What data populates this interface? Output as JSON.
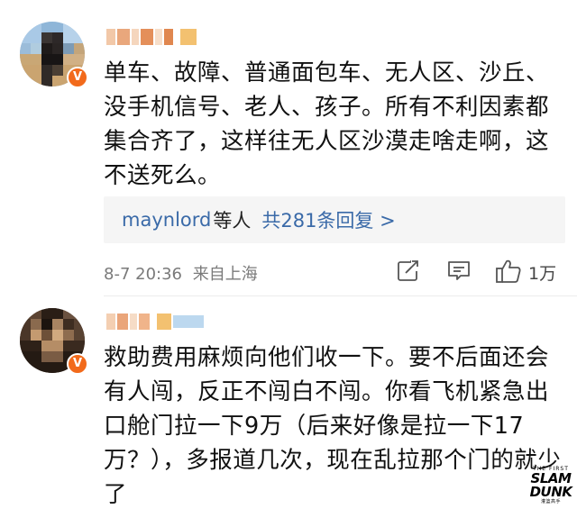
{
  "comments": [
    {
      "content": "单车、故障、普通面包车、无人区、沙丘、没手机信号、老人、孩子。所有不利因素都集合齐了，这样往无人区沙漠走啥走啊，这不送死么。",
      "replies": {
        "user": "maynlord",
        "mid": "等人",
        "count_text": "共281条回复 >"
      },
      "date": "8-7 20:36",
      "location": "来自上海",
      "likes": "1万"
    },
    {
      "content": "救助费用麻烦向他们收一下。要不后面还会有人闯，反正不闯白不闯。你看飞机紧急出口舱门拉一下9万（后来好像是拉一下17万？），多报道几次，现在乱拉那个门的就少了"
    }
  ],
  "watermark": {
    "line1": "THE FIRST",
    "line2": "SLAM",
    "line3": "DUNK",
    "line4": "灌篮高手"
  },
  "icons": {
    "share": "share-icon",
    "comment": "comment-icon",
    "like": "thumbs-up-icon",
    "badge": "verified-badge-icon"
  },
  "colors": {
    "link": "#3a6aa8",
    "meta": "#7a7a7a",
    "reply_bg": "#f5f5f5",
    "badge": "#f26a1b"
  }
}
